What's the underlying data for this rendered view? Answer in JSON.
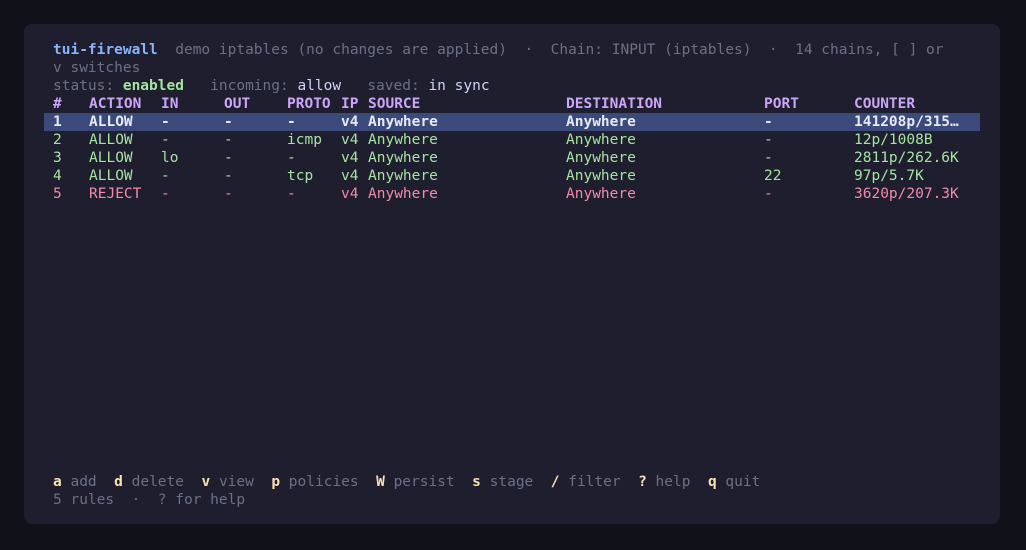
{
  "title": {
    "app": "tui-firewall",
    "mode": "demo iptables (no changes are applied)",
    "sep1": "·",
    "chain": "Chain: INPUT (iptables)",
    "sep2": "·",
    "chains_info_1": "14 chains, [ ] or",
    "chains_info_2": "v switches"
  },
  "status": {
    "status_label": "status:",
    "status_value": "enabled",
    "incoming_label": "incoming:",
    "incoming_value": "allow",
    "saved_label": "saved:",
    "saved_value": "in sync"
  },
  "table": {
    "headers": {
      "num": "#",
      "action": "ACTION",
      "in": "IN",
      "out": "OUT",
      "proto": "PROTO",
      "ip": "IP",
      "source": "SOURCE",
      "destination": "DESTINATION",
      "port": "PORT",
      "counter": "COUNTER"
    },
    "rows": [
      {
        "num": "1",
        "action": "ALLOW",
        "in": "-",
        "out": "-",
        "proto": "-",
        "ip": "v4",
        "source": "Anywhere",
        "destination": "Anywhere",
        "port": "-",
        "counter": "141208p/315…"
      },
      {
        "num": "2",
        "action": "ALLOW",
        "in": "-",
        "out": "-",
        "proto": "icmp",
        "ip": "v4",
        "source": "Anywhere",
        "destination": "Anywhere",
        "port": "-",
        "counter": "12p/1008B"
      },
      {
        "num": "3",
        "action": "ALLOW",
        "in": "lo",
        "out": "-",
        "proto": "-",
        "ip": "v4",
        "source": "Anywhere",
        "destination": "Anywhere",
        "port": "-",
        "counter": "2811p/262.6K"
      },
      {
        "num": "4",
        "action": "ALLOW",
        "in": "-",
        "out": "-",
        "proto": "tcp",
        "ip": "v4",
        "source": "Anywhere",
        "destination": "Anywhere",
        "port": "22",
        "counter": "97p/5.7K"
      },
      {
        "num": "5",
        "action": "REJECT",
        "in": "-",
        "out": "-",
        "proto": "-",
        "ip": "v4",
        "source": "Anywhere",
        "destination": "Anywhere",
        "port": "-",
        "counter": "3620p/207.3K"
      }
    ]
  },
  "keybar": [
    {
      "key": "a",
      "label": "add"
    },
    {
      "key": "d",
      "label": "delete"
    },
    {
      "key": "v",
      "label": "view"
    },
    {
      "key": "p",
      "label": "policies"
    },
    {
      "key": "W",
      "label": "persist"
    },
    {
      "key": "s",
      "label": "stage"
    },
    {
      "key": "/",
      "label": "filter"
    },
    {
      "key": "?",
      "label": "help"
    },
    {
      "key": "q",
      "label": "quit"
    }
  ],
  "footer": {
    "count": "5 rules",
    "sep": "·",
    "hint": "? for help"
  },
  "colors": {
    "background": "#1e1e2e",
    "title": "#89b4fa",
    "header": "#cba6f7",
    "allow": "#a6e3a1",
    "reject": "#f38ba8",
    "selected": "#3b4a7a",
    "key": "#f9e2af"
  }
}
